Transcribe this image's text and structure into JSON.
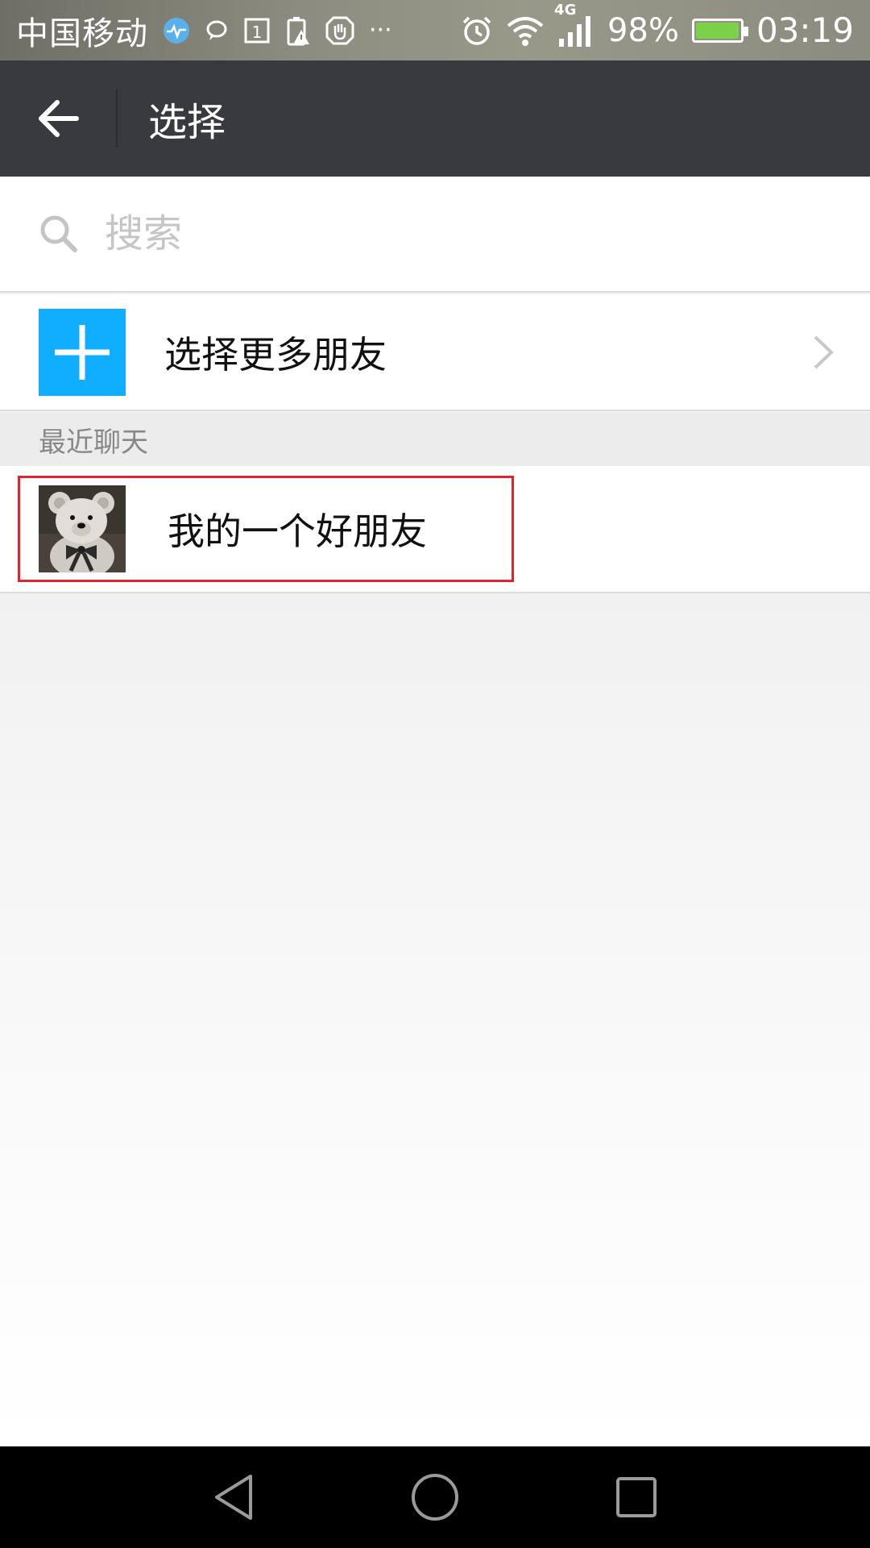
{
  "status_bar": {
    "carrier": "中国移动",
    "network": "4G",
    "battery_percent": "98%",
    "battery_level": 0.98,
    "time": "03:19",
    "icons": [
      "health-icon",
      "chat-bubble-icon",
      "calendar-icon",
      "battery-alert-icon",
      "hand-icon",
      "more-dots-icon",
      "alarm-icon",
      "wifi-icon",
      "signal-icon",
      "battery-icon"
    ],
    "calendar_day": "1",
    "more_dots": "···"
  },
  "header": {
    "title": "选择",
    "back_icon": "arrow-left-icon"
  },
  "search": {
    "placeholder": "搜索",
    "value": ""
  },
  "select_more": {
    "label": "选择更多朋友",
    "icon": "plus-icon",
    "accent": "#10aeff"
  },
  "recent_section": {
    "title": "最近聊天"
  },
  "contacts": [
    {
      "name": "我的一个好朋友",
      "avatar": "teddy-bear-avatar",
      "highlighted": true,
      "highlight_color": "#e0242e"
    }
  ],
  "nav_bar": {
    "buttons": [
      "back-triangle-icon",
      "home-circle-icon",
      "recents-square-icon"
    ]
  },
  "colors": {
    "header_bg": "#393a3f",
    "page_bg": "#f2f2f2"
  }
}
